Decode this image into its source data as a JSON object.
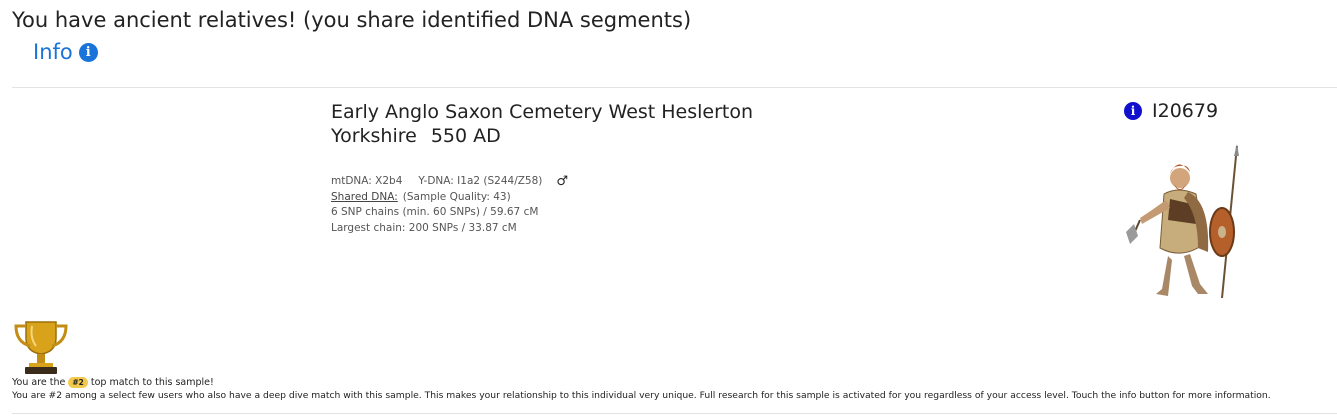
{
  "header": {
    "title": "You have ancient relatives! (you share identified DNA segments)",
    "info_label": "Info",
    "info_icon": "i"
  },
  "sample": {
    "title": "Early Anglo Saxon Cemetery West Heslerton Yorkshire",
    "date": "550 AD",
    "mtdna": "mtDNA: X2b4",
    "ydna": "Y-DNA: I1a2 (S244/Z58)",
    "sex_icon": "♂",
    "shared_dna_label": "Shared DNA:",
    "sample_quality": "(Sample Quality: 43)",
    "snp_chains": "6 SNP chains (min. 60 SNPs) / 59.67 cM",
    "largest_chain": "Largest chain: 200 SNPs / 33.87 cM",
    "id_info_icon": "i",
    "sample_id": "I20679"
  },
  "match": {
    "prefix": "You are the",
    "rank": "#2",
    "suffix": "top match to this sample!",
    "unique_text": "You are #2 among a select few users who also have a deep dive match with this sample. This makes your relationship to this individual very unique. Full research for this sample is activated for you regardless of your access level. Touch the info button for more information."
  },
  "colors": {
    "accent_blue": "#1a73d9",
    "id_info_blue": "#1111cc",
    "badge_gold": "#f2c94c",
    "trophy_gold": "#d9a21b"
  },
  "icons": {
    "info": "info-icon",
    "sex": "male-symbol-icon",
    "trophy": "trophy-icon",
    "figure": "warrior-figure-image"
  }
}
